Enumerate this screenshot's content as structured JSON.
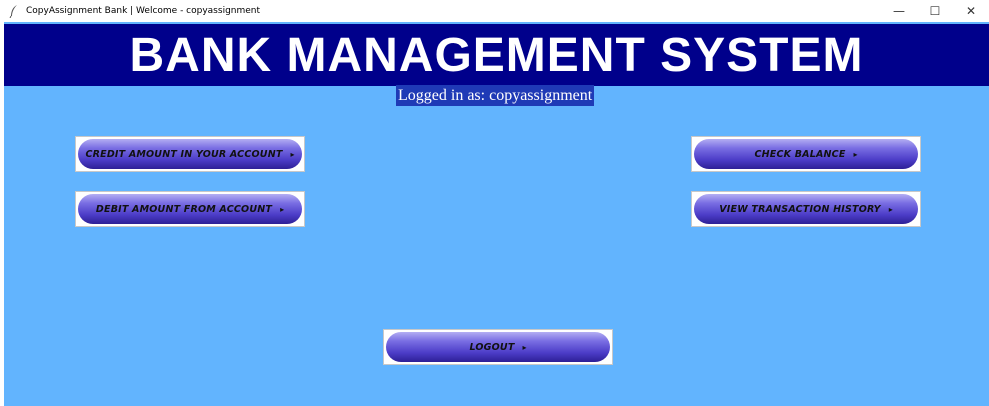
{
  "window": {
    "title": "CopyAssignment Bank | Welcome - copyassignment",
    "minimize_glyph": "—",
    "maximize_glyph": "☐",
    "close_glyph": "✕",
    "app_icon": "feather-icon"
  },
  "header": {
    "title": "BANK MANAGEMENT SYSTEM"
  },
  "status": {
    "logged_in": "Logged in as: copyassignment"
  },
  "buttons": {
    "credit": "CREDIT AMOUNT IN YOUR ACCOUNT",
    "debit": "DEBIT AMOUNT FROM ACCOUNT",
    "check_balance": "CHECK BALANCE",
    "view_history": "VIEW TRANSACTION HISTORY",
    "logout": "LOGOUT",
    "arrow": "▸"
  },
  "colors": {
    "background": "#62b4fe",
    "header_bar": "#00008b",
    "logged_in_bg": "#1f3ab6",
    "button_gradient_top": "#b3aef3",
    "button_gradient_bottom": "#2d1f96"
  }
}
